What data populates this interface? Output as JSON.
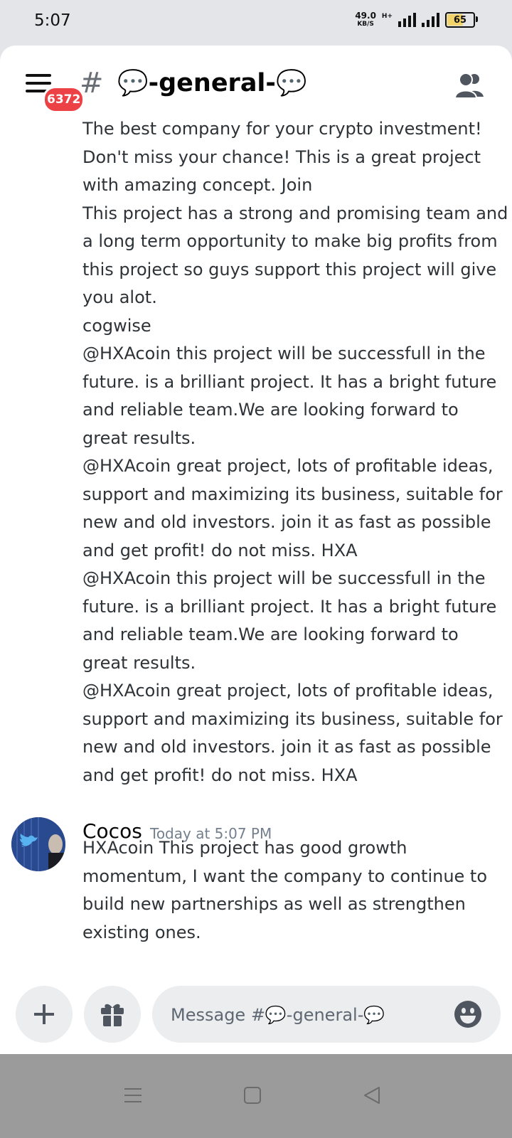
{
  "status_bar": {
    "time": "5:07",
    "net_speed_value": "49.0",
    "net_speed_unit": "KB/S",
    "network_type": "H+",
    "battery_percent": "65",
    "battery_level": 0.65
  },
  "header": {
    "channel_hash": "#",
    "channel_name": "💬-general-💬",
    "unread_badge": "6372"
  },
  "messages": {
    "continuation_lines": [
      " The   best company for your crypto investment!",
      "Don't miss your chance! This is a   great project",
      "with amazing concept. Join",
      "This project has a strong and promising team and",
      "a long term opportunity to make big profits from",
      "this project so guys support this project will give",
      "you alot.",
      "cogwise",
      "@HXAcoin this project will be successfull in the",
      "future. is a brilliant project. It has a bright future",
      "and reliable team.We are looking forward to",
      "great results.",
      "@HXAcoin great project, lots of profitable ideas,",
      "support and maximizing its business, suitable for",
      "new and old investors. join it as fast as possible",
      "and get profit! do not miss. HXA",
      "@HXAcoin this project will be successfull in the",
      "future. is a brilliant project. It has a bright future",
      "and reliable team.We are looking forward to",
      "great results.",
      "@HXAcoin great project, lots of profitable ideas,",
      "support and maximizing its business, suitable for",
      "new and old investors. join it as fast as possible",
      "and get profit! do not miss. HXA"
    ],
    "last_message": {
      "author": "Cocos",
      "timestamp": "Today at 5:07 PM",
      "lines": [
        "HXAcoin This project has good growth",
        "momentum, I want the company to continue to",
        "build new partnerships as well as strengthen",
        "existing ones."
      ]
    }
  },
  "composer": {
    "placeholder": "Message #💬-general-💬"
  },
  "icons": {
    "menu": "hamburger-menu-icon",
    "members": "members-icon",
    "add": "plus-icon",
    "gift": "gift-icon",
    "emoji": "smiley-face-icon",
    "nav_recents": "recents-icon",
    "nav_home": "home-square-icon",
    "nav_back": "back-triangle-icon"
  },
  "colors": {
    "badge_red": "#ed4245",
    "text_primary": "#2e3338",
    "timestamp_gray": "#747f8d",
    "input_bg": "#ebedef",
    "nav_bar_gray": "#9b9b9b"
  }
}
